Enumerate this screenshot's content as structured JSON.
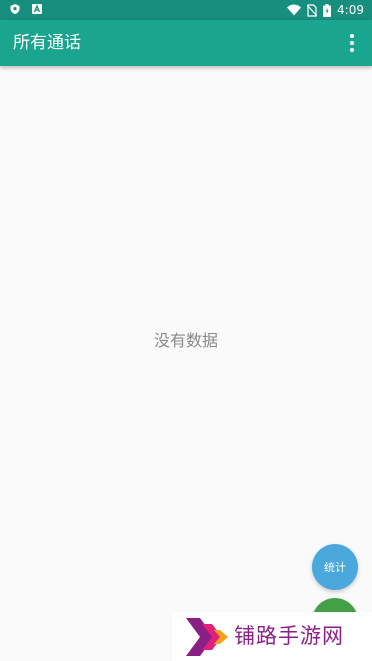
{
  "status_bar": {
    "time": "4:09",
    "left_icons": [
      "shield-icon",
      "keyboard-a-icon"
    ],
    "right_icons": [
      "wifi-icon",
      "no-sim-icon",
      "battery-icon"
    ]
  },
  "app_bar": {
    "title": "所有通话",
    "menu_icon": "overflow-menu-icon",
    "color": "#1aa58f"
  },
  "main": {
    "empty_message": "没有数据"
  },
  "fabs": {
    "stats_label": "统计",
    "stats_color": "#4aa8dc",
    "second_color": "#43a047"
  },
  "watermark": {
    "text": "铺路手游网"
  }
}
